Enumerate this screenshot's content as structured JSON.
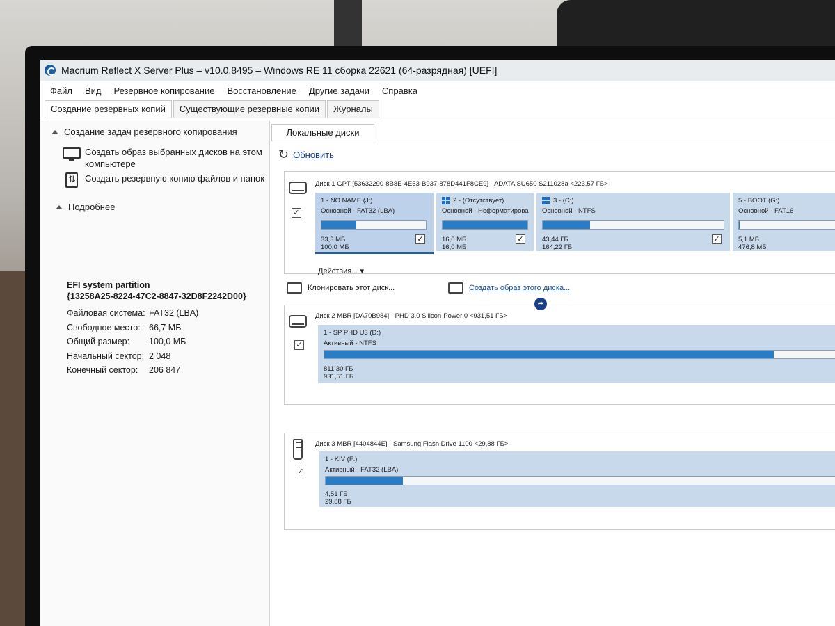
{
  "window": {
    "title": "Macrium Reflect X Server Plus – v10.0.8495 – Windows RE 11 сборка 22621 (64-разрядная)  [UEFI]"
  },
  "menu": [
    "Файл",
    "Вид",
    "Резервное копирование",
    "Восстановление",
    "Другие задачи",
    "Справка"
  ],
  "tabs": [
    "Создание резервных копий",
    "Существующие резервные копии",
    "Журналы"
  ],
  "left": {
    "tasks_header": "Создание задач резервного копирования",
    "task_image": "Создать образ выбранных дисков на этом компьютере",
    "task_files": "Создать резервную копию файлов и папок",
    "details_header": "Подробнее",
    "details": {
      "name_line1": "EFI system partition",
      "name_line2": "{13258A25-8224-47C2-8847-32D8F2242D00}",
      "rows": [
        {
          "k": "Файловая система:",
          "v": "FAT32 (LBA)"
        },
        {
          "k": "Свободное место:",
          "v": "66,7 МБ"
        },
        {
          "k": "Общий размер:",
          "v": "100,0 МБ"
        },
        {
          "k": "Начальный сектор:",
          "v": "2 048"
        },
        {
          "k": "Конечный сектор:",
          "v": "206 847"
        }
      ]
    }
  },
  "right": {
    "tab": "Локальные диски",
    "refresh": "Обновить",
    "disk1": {
      "title": "Диск 1 GPT [53632290-8B8E-4E53-B937-878D441F8CE9] - ADATA SU650 S211028a  <223,57 ГБ>",
      "partitions": [
        {
          "name": "1 - NO NAME (J:)",
          "type": "Основной - FAT32 (LBA)",
          "used": "33,3 МБ",
          "total": "100,0 МБ",
          "fill": 0.33
        },
        {
          "name": "2 -  (Отсутствует)",
          "type": "Основной - Неформатирова",
          "used": "16,0 МБ",
          "total": "16,0 МБ",
          "fill": 1.0
        },
        {
          "name": "3 -  (C:)",
          "type": "Основной - NTFS",
          "used": "43,44 ГБ",
          "total": "164,22 ГБ",
          "fill": 0.26
        },
        {
          "name": "5 - BOOT (G:)",
          "type": "Основной - FAT16",
          "used": "5,1 МБ",
          "total": "476,8 МБ",
          "fill": 0.01
        }
      ],
      "actions": "Действия...",
      "clone": "Клонировать этот диск...",
      "image": "Создать образ этого диска..."
    },
    "disk2": {
      "title": "Диск 2 MBR [DA70B984] - PHD 3.0  Silicon-Power    0  <931,51 ГБ>",
      "partition": {
        "name": "1 - SP PHD U3 (D:)",
        "type": "Активный - NTFS",
        "used": "811,30 ГБ",
        "total": "931,51 ГБ",
        "fill": 0.87
      }
    },
    "disk3": {
      "title": "Диск 3 MBR [4404844E] - Samsung  Flash Drive     1100  <29,88 ГБ>",
      "partition": {
        "name": "1 - KIV (F:)",
        "type": "Активный - FAT32 (LBA)",
        "used": "4,51 ГБ",
        "total": "29,88 ГБ",
        "fill": 0.15
      }
    }
  },
  "colors": {
    "accent": "#2a7dc4",
    "partition_bg": "#c9d9ec",
    "link": "#1a4fa0"
  }
}
